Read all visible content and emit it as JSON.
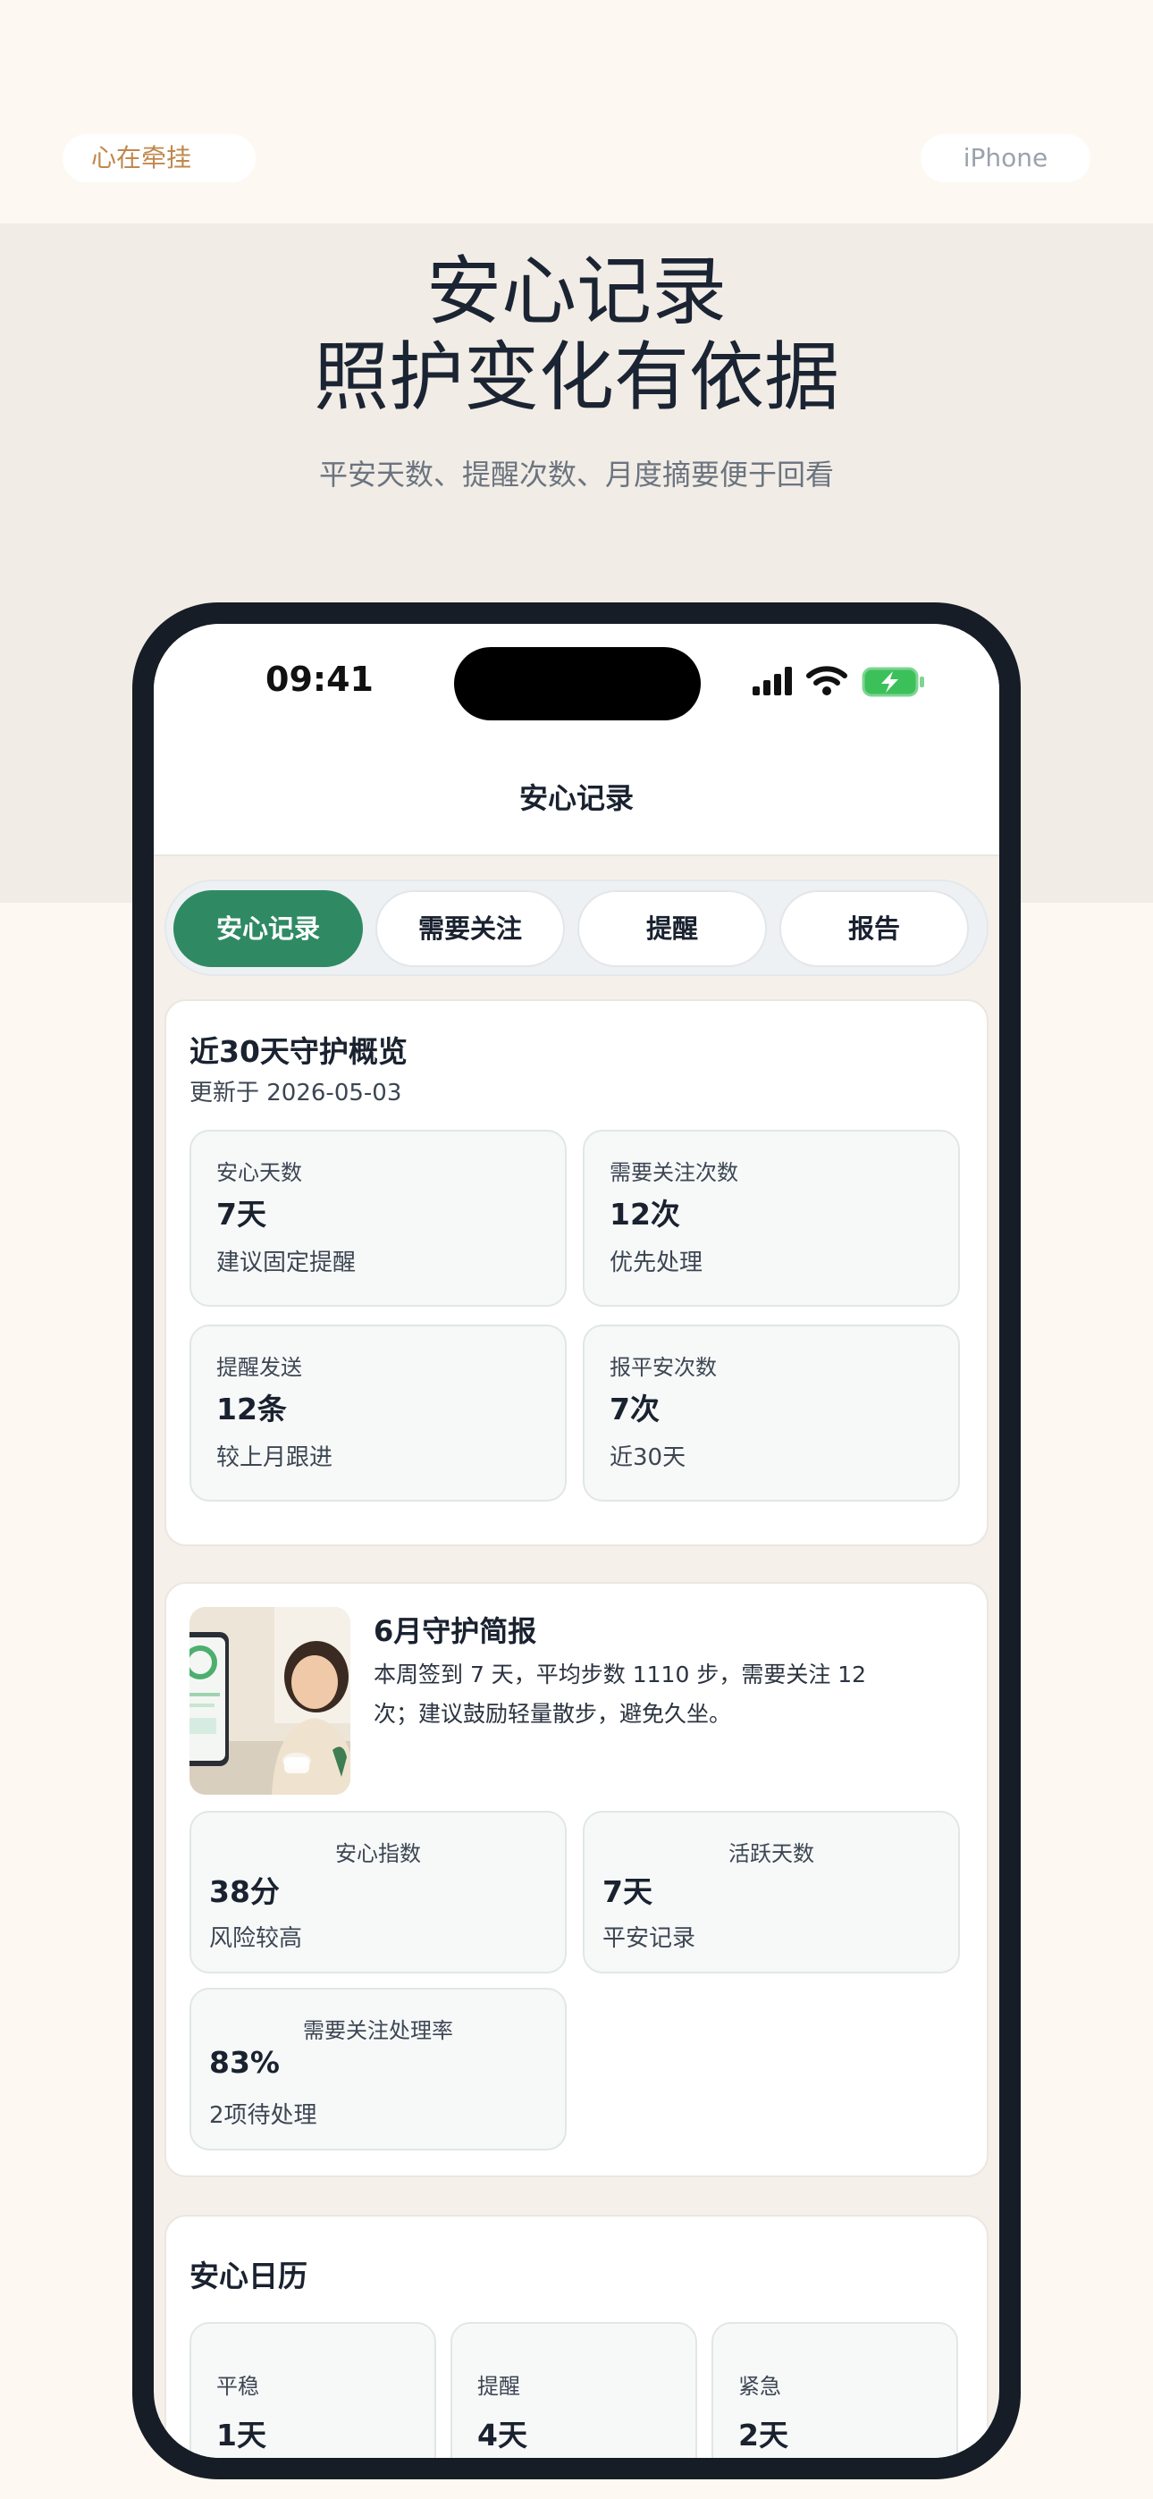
{
  "header": {
    "brand_pill": "心在牵挂",
    "device_pill": "iPhone",
    "headline_line1": "安心记录",
    "headline_line2": "照护变化有依据",
    "subline": "平安天数、提醒次数、月度摘要便于回看"
  },
  "status_bar": {
    "time": "09:41",
    "icons": [
      "signal-icon",
      "wifi-icon",
      "battery-charging-icon"
    ]
  },
  "nav": {
    "title": "安心记录"
  },
  "tabs": [
    {
      "label": "安心记录",
      "active": true
    },
    {
      "label": "需要关注",
      "active": false
    },
    {
      "label": "提醒",
      "active": false
    },
    {
      "label": "报告",
      "active": false
    }
  ],
  "overview": {
    "title": "近30天守护概览",
    "updated": "更新于 2026-05-03",
    "stats": [
      {
        "label": "安心天数",
        "value": "7天",
        "sub": "建议固定提醒"
      },
      {
        "label": "需要关注次数",
        "value": "12次",
        "sub": "优先处理"
      },
      {
        "label": "提醒发送",
        "value": "12条",
        "sub": "较上月跟进"
      },
      {
        "label": "报平安次数",
        "value": "7次",
        "sub": "近30天"
      }
    ]
  },
  "brief": {
    "title": "6月守护简报",
    "text": "本周签到 7 天，平均步数 1110 步，需要关注 12 次；建议鼓励轻量散步，避免久坐。",
    "metrics": [
      {
        "label": "安心指数",
        "value": "38分",
        "sub": "风险较高"
      },
      {
        "label": "活跃天数",
        "value": "7天",
        "sub": "平安记录"
      },
      {
        "label": "需要关注处理率",
        "value": "83%",
        "sub": "2项待处理"
      }
    ]
  },
  "calendar": {
    "title": "安心日历",
    "items": [
      {
        "label": "平稳",
        "value": "1天"
      },
      {
        "label": "提醒",
        "value": "4天"
      },
      {
        "label": "紧急",
        "value": "2天"
      }
    ]
  },
  "colors": {
    "accent": "#2f8a64",
    "brand_text": "#c0884c",
    "page_bg": "#fdf8f2",
    "band_bg": "#f1ece5",
    "phone_frame": "#161d26",
    "battery_green": "#3cc15a"
  }
}
